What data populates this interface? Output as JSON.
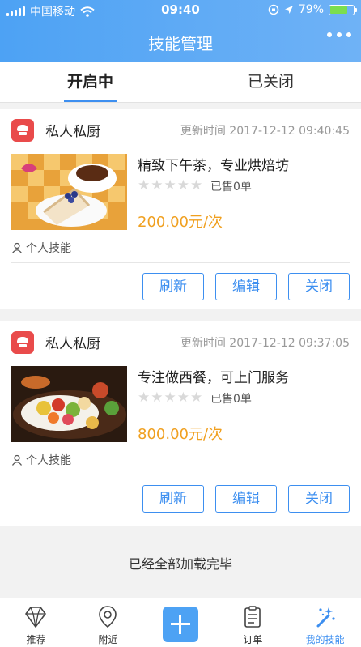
{
  "status_bar": {
    "carrier": "中国移动",
    "time": "09:40",
    "battery": "79%",
    "battery_level": 0.79
  },
  "header": {
    "title": "技能管理",
    "more_icon": "more-dots-icon"
  },
  "tabs": [
    {
      "label": "开启中",
      "active": true
    },
    {
      "label": "已关闭",
      "active": false
    }
  ],
  "cards": [
    {
      "shop_name": "私人私厨",
      "update_time": "更新时间 2017-12-12 09:40:45",
      "title": "精致下午茶，专业烘焙坊",
      "rating": 0,
      "sold": "已售0单",
      "price": "200.00元/次",
      "skill_type": "个人技能",
      "buttons": {
        "refresh": "刷新",
        "edit": "编辑",
        "close": "关闭"
      }
    },
    {
      "shop_name": "私人私厨",
      "update_time": "更新时间 2017-12-12 09:37:05",
      "title": "专注做西餐，可上门服务",
      "rating": 0,
      "sold": "已售0单",
      "price": "800.00元/次",
      "skill_type": "个人技能",
      "buttons": {
        "refresh": "刷新",
        "edit": "编辑",
        "close": "关闭"
      }
    }
  ],
  "list_end_message": "已经全部加载完毕",
  "tab_bar": [
    {
      "label": "推荐",
      "icon": "diamond-icon"
    },
    {
      "label": "附近",
      "icon": "location-pin-icon"
    },
    {
      "label": "",
      "icon": "plus-icon"
    },
    {
      "label": "订单",
      "icon": "clipboard-icon"
    },
    {
      "label": "我的技能",
      "icon": "magic-wand-icon",
      "active": true
    }
  ],
  "colors": {
    "accent": "#3d8ff0",
    "header": "#4da2f4",
    "price": "#f0a020",
    "logo": "#e94b4b"
  }
}
